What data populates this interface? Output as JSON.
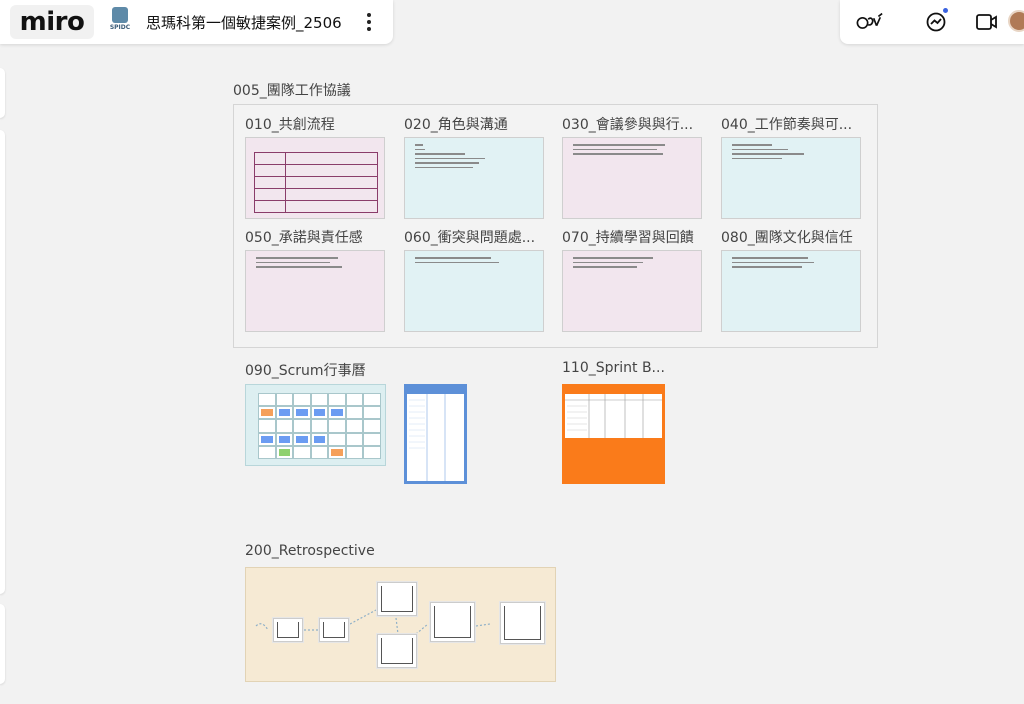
{
  "app": {
    "logo_text": "miro",
    "board_icon_text": "SPIDC",
    "board_title": "思瑪科第一個敏捷案例_2506"
  },
  "toolbar_right": {
    "icons": [
      "reactions-icon",
      "chat-icon",
      "video-call-icon",
      "avatar"
    ],
    "notification": true
  },
  "canvas": {
    "group_title": "005_團隊工作協議",
    "cards": [
      {
        "title": "010_共創流程",
        "color": "pink"
      },
      {
        "title": "020_角色與溝通",
        "color": "blue"
      },
      {
        "title": "030_會議參與與行...",
        "color": "pink"
      },
      {
        "title": "040_工作節奏與可...",
        "color": "blue"
      },
      {
        "title": "050_承諾與責任感",
        "color": "pink"
      },
      {
        "title": "060_衝突與問題處...",
        "color": "blue"
      },
      {
        "title": "070_持續學習與回饋",
        "color": "pink"
      },
      {
        "title": "080_團隊文化與信任",
        "color": "blue"
      }
    ],
    "scrum_title": "090_Scrum行事曆",
    "sprint_title": "110_Sprint B...",
    "retro_title": "200_Retrospective"
  },
  "colors": {
    "pink_card": "#f2e6ee",
    "blue_card": "#e1f2f4",
    "backlog_blue": "#5d90d8",
    "sprint_orange": "#fa7b1a",
    "retro_bg": "#f6ead4"
  }
}
